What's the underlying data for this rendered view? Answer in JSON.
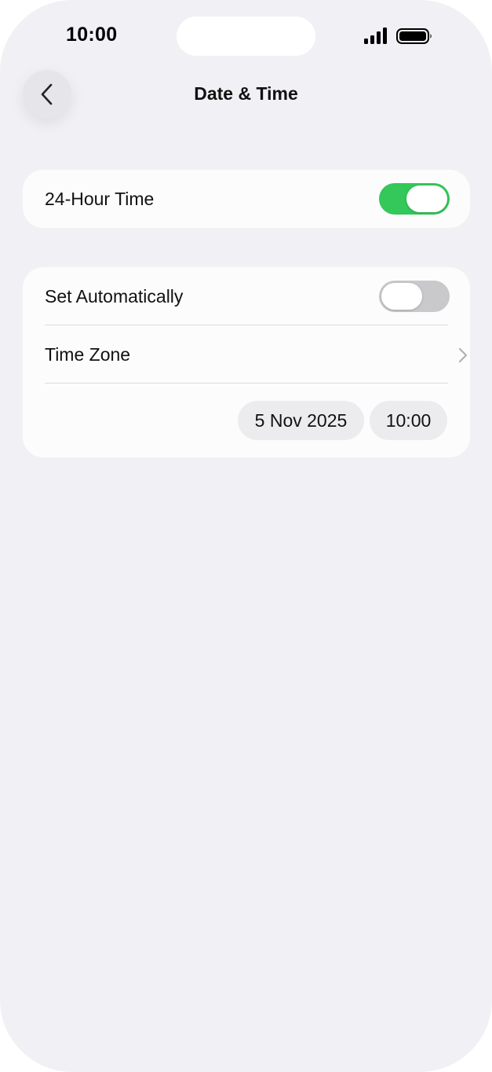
{
  "status_bar": {
    "time": "10:00",
    "signal_icon": "cellular-signal-icon",
    "battery_icon": "battery-icon"
  },
  "nav": {
    "back_icon": "chevron-left-icon",
    "title": "Date & Time"
  },
  "settings": {
    "twenty_four_hour": {
      "label": "24-Hour Time",
      "enabled": true
    },
    "set_automatically": {
      "label": "Set Automatically",
      "enabled": false
    },
    "time_zone": {
      "label": "Time Zone",
      "icon": "chevron-right-icon"
    },
    "date_value": "5 Nov 2025",
    "time_value": "10:00"
  },
  "colors": {
    "toggle_on": "#34c759",
    "toggle_off": "#c9c9cc",
    "background": "#f0f0f5",
    "card": "#fcfcfd"
  }
}
